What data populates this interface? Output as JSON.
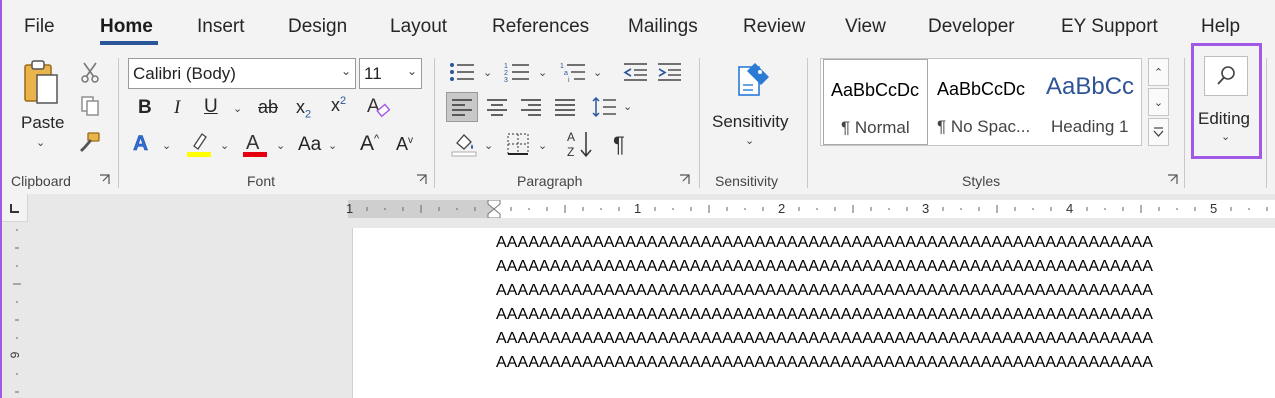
{
  "menubar": {
    "tabs": [
      {
        "label": "File"
      },
      {
        "label": "Home"
      },
      {
        "label": "Insert"
      },
      {
        "label": "Design"
      },
      {
        "label": "Layout"
      },
      {
        "label": "References"
      },
      {
        "label": "Mailings"
      },
      {
        "label": "Review"
      },
      {
        "label": "View"
      },
      {
        "label": "Developer"
      },
      {
        "label": "EY Support"
      },
      {
        "label": "Help"
      }
    ],
    "active_tab": "Home"
  },
  "ribbon": {
    "clipboard": {
      "label": "Clipboard",
      "paste_label": "Paste"
    },
    "font": {
      "label": "Font",
      "font_name": "Calibri (Body)",
      "font_size": "11",
      "change_case_label": "Aa"
    },
    "paragraph": {
      "label": "Paragraph"
    },
    "sensitivity": {
      "label": "Sensitivity",
      "button_label": "Sensitivity"
    },
    "styles": {
      "label": "Styles",
      "items": [
        {
          "sample": "AaBbCcDc",
          "name": "¶ Normal"
        },
        {
          "sample": "AaBbCcDc",
          "name": "¶ No Spac..."
        },
        {
          "sample": "AaBbCc",
          "name": "Heading 1"
        }
      ]
    },
    "editing": {
      "label": "Editing"
    }
  },
  "ruler": {
    "numbers": [
      "1",
      "1",
      "2",
      "3",
      "4",
      "5"
    ],
    "vertical_number": "6"
  },
  "document": {
    "lines": [
      "AAAAAAAAAAAAAAAAAAAAAAAAAAAAAAAAAAAAAAAAAAAAAAAAAAAAAAAAAAAAA",
      "AAAAAAAAAAAAAAAAAAAAAAAAAAAAAAAAAAAAAAAAAAAAAAAAAAAAAAAAAAAAA",
      "AAAAAAAAAAAAAAAAAAAAAAAAAAAAAAAAAAAAAAAAAAAAAAAAAAAAAAAAAAAAA",
      "AAAAAAAAAAAAAAAAAAAAAAAAAAAAAAAAAAAAAAAAAAAAAAAAAAAAAAAAAAAAA",
      "AAAAAAAAAAAAAAAAAAAAAAAAAAAAAAAAAAAAAAAAAAAAAAAAAAAAAAAAAAAAA",
      "AAAAAAAAAAAAAAAAAAAAAAAAAAAAAAAAAAAAAAAAAAAAAAAAAAAAAAAAAAAAA"
    ]
  },
  "colors": {
    "accent": "#2b579a",
    "highlight_box": "#a259e6",
    "font_color": "#e3000f",
    "highlight_color": "#ffff00"
  }
}
